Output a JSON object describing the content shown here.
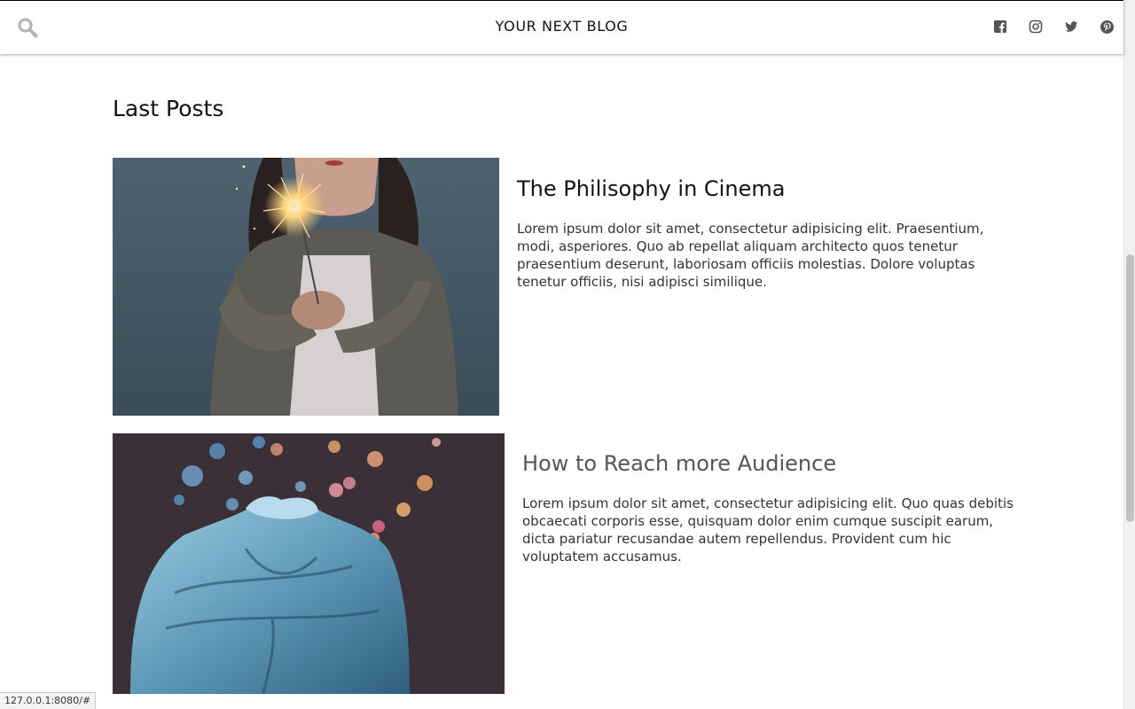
{
  "header": {
    "brand": "YOUR NEXT BLOG",
    "search_icon": "search-icon",
    "social": [
      {
        "name": "facebook",
        "icon": "facebook-icon"
      },
      {
        "name": "instagram",
        "icon": "instagram-icon"
      },
      {
        "name": "twitter",
        "icon": "twitter-icon"
      },
      {
        "name": "pinterest",
        "icon": "pinterest-icon"
      }
    ]
  },
  "section": {
    "title": "Last Posts"
  },
  "posts": [
    {
      "title": "The Philisophy in Cinema",
      "excerpt": "Lorem ipsum dolor sit amet, consectetur adipisicing elit. Praesentium, modi, asperiores. Quo ab repellat aliquam architecto quos tenetur praesentium deserunt, laboriosam officiis molestias. Dolore voluptas tenetur officiis, nisi adipisci similique.",
      "image": "woman-holding-sparkler-photo"
    },
    {
      "title": "How to Reach more Audience",
      "excerpt": "Lorem ipsum dolor sit amet, consectetur adipisicing elit. Quo quas debitis obcaecati corporis esse, quisquam dolor enim cumque suscipit earum, dicta pariatur recusandae autem repellendus. Provident cum hic voluptatem accusamus.",
      "image": "blue-sculpture-bokeh-photo"
    }
  ],
  "status_bar": {
    "url": "127.0.0.1:8080/#"
  },
  "colors": {
    "text": "#111111",
    "muted_title": "#555555",
    "icon": "#555555"
  }
}
